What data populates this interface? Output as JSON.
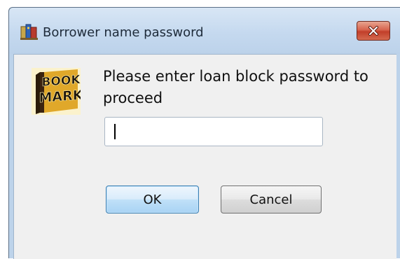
{
  "window": {
    "title": "Borrower name password",
    "app_icon": "books-icon",
    "close_icon": "close-icon"
  },
  "logo": {
    "name": "bookmark-logo",
    "text_top": "BOOK",
    "text_bottom": "MARK"
  },
  "dialog": {
    "prompt": "Please enter loan block password to proceed",
    "password_value": "",
    "ok_label": "OK",
    "cancel_label": "Cancel"
  },
  "colors": {
    "titlebar": "#c5d9ef",
    "close_button": "#c84a33",
    "ok_border": "#3c7fb1",
    "dialog_bg": "#f0f0f0"
  }
}
